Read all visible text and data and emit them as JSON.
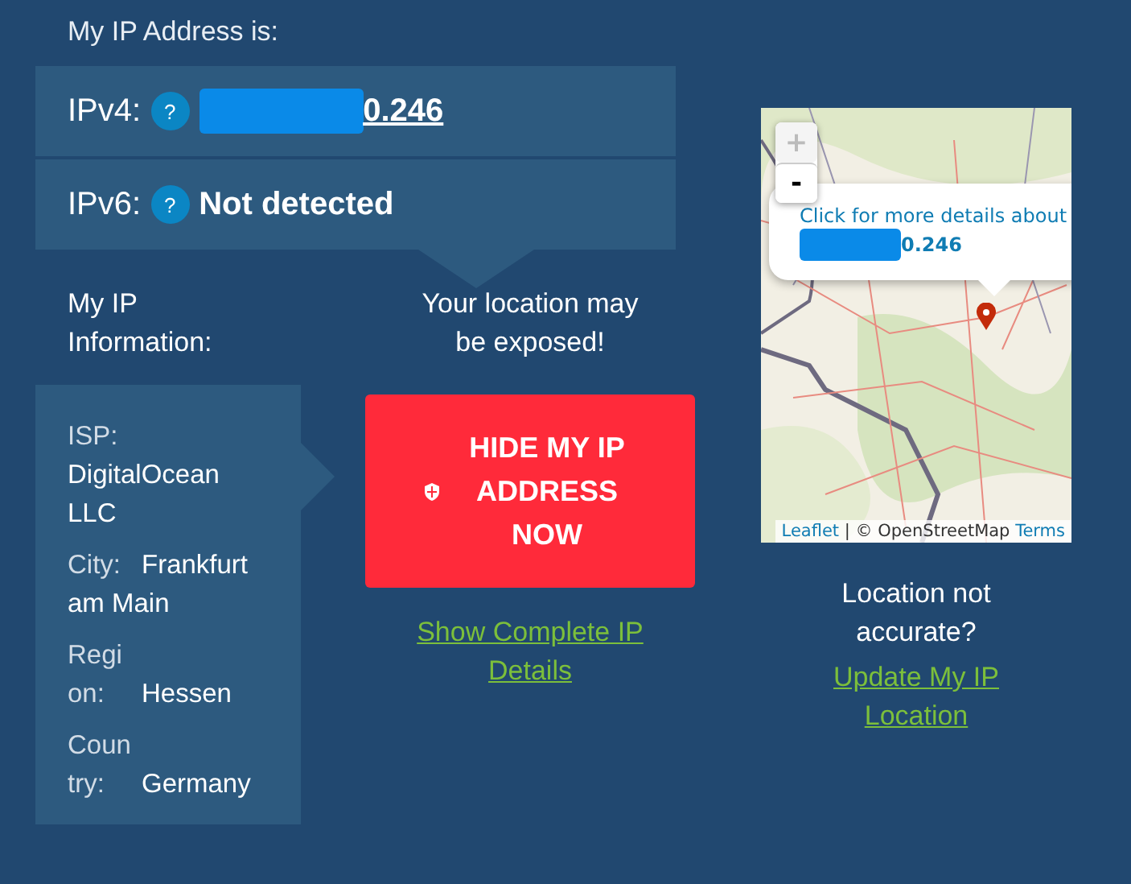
{
  "heading": "My IP Address is:",
  "addresses": [
    {
      "label": "IPv4:",
      "help": "?",
      "redacted": true,
      "value": "0.246",
      "kind": "link"
    },
    {
      "label": "IPv6:",
      "help": "?",
      "redacted": false,
      "value": "Not detected",
      "kind": "text"
    }
  ],
  "info_heading": "My IP Information:",
  "warning": "Your location may be exposed!",
  "info": [
    {
      "label": "ISP:",
      "value": "DigitalOcean LLC"
    },
    {
      "label": "City:",
      "value": "Frankfurt am Main"
    },
    {
      "label": "Region:",
      "value": "Hessen"
    },
    {
      "label": "Country:",
      "value": "Germany"
    }
  ],
  "hide_button": "HIDE MY IP ADDRESS NOW",
  "details_link": "Show Complete IP Details",
  "map": {
    "zoom_in": "+",
    "zoom_out": "-",
    "zoom_in_disabled": true,
    "popup_text": "Click for more details about",
    "popup_ip": "0.246",
    "attribution_link": "Leaflet",
    "attribution_sep": "|",
    "attribution_text": "© OpenStreetMap",
    "attribution_terms": "Terms"
  },
  "accuracy_note": "Location not accurate?",
  "update_link": "Update My IP Location"
}
